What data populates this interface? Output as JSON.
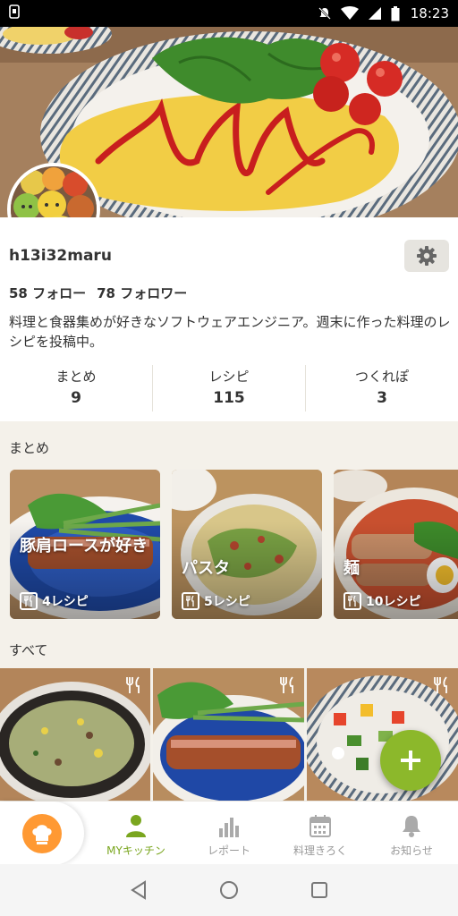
{
  "status_bar": {
    "time": "18:23",
    "icons": [
      "screenshot-icon",
      "notifications-muted-icon",
      "wifi-icon",
      "cell-signal-icon",
      "battery-icon"
    ]
  },
  "profile": {
    "username": "h13i32maru",
    "following_count": "58",
    "following_label": "フォロー",
    "followers_count": "78",
    "followers_label": "フォロワー",
    "bio": "料理と食器集めが好きなソフトウェアエンジニア。週末に作った料理のレシピを投稿中。",
    "settings_icon": "gear-icon"
  },
  "stats": [
    {
      "label": "まとめ",
      "value": "9"
    },
    {
      "label": "レシピ",
      "value": "115"
    },
    {
      "label": "つくれぽ",
      "value": "3"
    }
  ],
  "collections_section": {
    "title": "まとめ",
    "items": [
      {
        "title": "豚肩ロースが好き",
        "count": "4レシピ"
      },
      {
        "title": "パスタ",
        "count": "5レシピ"
      },
      {
        "title": "麺",
        "count": "10レシピ"
      }
    ]
  },
  "recipes_section": {
    "title": "すべて"
  },
  "fab": {
    "icon": "plus-icon"
  },
  "bottom_nav": {
    "items": [
      {
        "label": "MYキッチン",
        "icon": "person-icon",
        "active": true
      },
      {
        "label": "レポート",
        "icon": "bar-chart-icon",
        "active": false
      },
      {
        "label": "料理きろく",
        "icon": "calendar-icon",
        "active": false
      },
      {
        "label": "お知らせ",
        "icon": "bell-icon",
        "active": false
      }
    ]
  },
  "colors": {
    "accent_green": "#8cb82b",
    "nav_active_green": "#7aa61f",
    "chef_orange": "#ff9933",
    "background": "#f4f1ea"
  }
}
